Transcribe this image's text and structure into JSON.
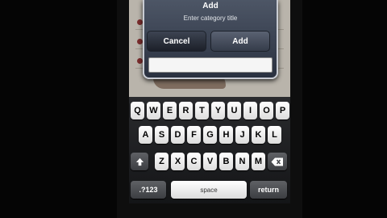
{
  "dialog": {
    "title": "Add",
    "message": "Enter category title",
    "cancel_label": "Cancel",
    "add_label": "Add",
    "title_field_value": ""
  },
  "keyboard": {
    "row1": [
      "Q",
      "W",
      "E",
      "R",
      "T",
      "Y",
      "U",
      "I",
      "O",
      "P"
    ],
    "row2": [
      "A",
      "S",
      "D",
      "F",
      "G",
      "H",
      "J",
      "K",
      "L"
    ],
    "row3": [
      "Z",
      "X",
      "C",
      "V",
      "B",
      "N",
      "M"
    ],
    "shift_icon": "shift-arrow-icon",
    "backspace_icon": "backspace-icon",
    "numbers_label": ".?123",
    "space_label": "space",
    "return_label": "return"
  },
  "colors": {
    "dialog_bg": "#3b4352",
    "keyboard_bg": "#1e1f22",
    "key_light": "#f2f2f2",
    "key_dark": "#4d4f53"
  }
}
